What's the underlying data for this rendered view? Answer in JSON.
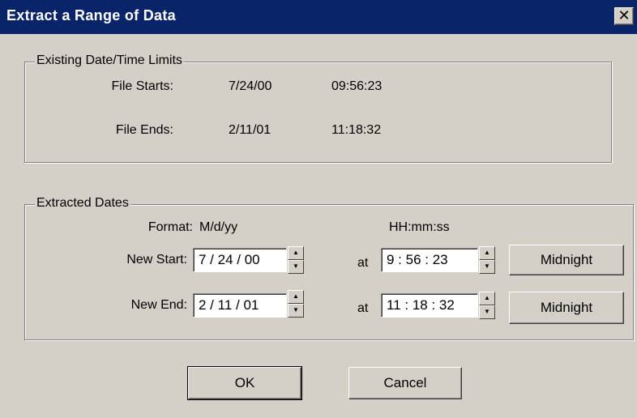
{
  "window": {
    "title": "Extract a Range of Data",
    "close_glyph": "✕"
  },
  "existing": {
    "legend": "Existing Date/Time Limits",
    "file_starts_label": "File Starts:",
    "file_starts_date": "7/24/00",
    "file_starts_time": "09:56:23",
    "file_ends_label": "File Ends:",
    "file_ends_date": "2/11/01",
    "file_ends_time": "11:18:32"
  },
  "extracted": {
    "legend": "Extracted Dates",
    "format_label": "Format:",
    "date_format": "M/d/yy",
    "time_format": "HH:mm:ss",
    "new_start_label": "New Start:",
    "new_start_date": "7 / 24 / 00",
    "new_start_at": "at",
    "new_start_time": "9 : 56 : 23",
    "new_end_label": "New End:",
    "new_end_date": "2 / 11 / 01",
    "new_end_at": "at",
    "new_end_time": "11 : 18 : 32",
    "midnight_label": "Midnight"
  },
  "buttons": {
    "ok": "OK",
    "cancel": "Cancel"
  },
  "icons": {
    "spin_up": "▲",
    "spin_down": "▼"
  }
}
